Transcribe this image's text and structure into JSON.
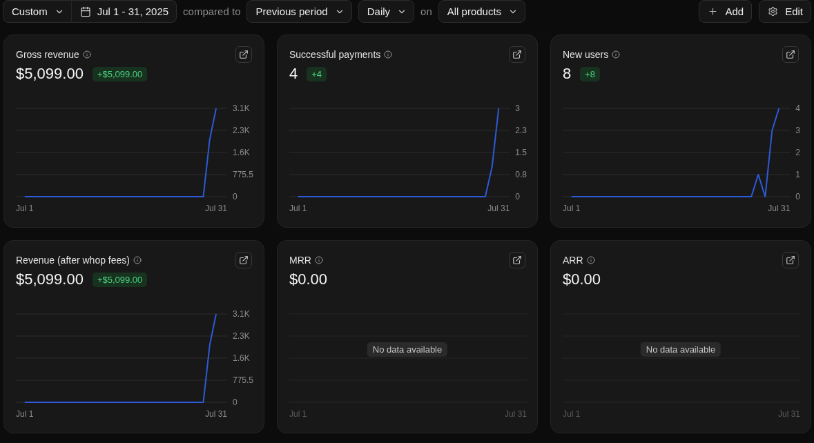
{
  "toolbar": {
    "range_select": "Custom",
    "date_range": "Jul 1 - 31, 2025",
    "compare_label": "compared to",
    "compare_select": "Previous period",
    "interval_select": "Daily",
    "on_label": "on",
    "product_select": "All products",
    "actions": [
      {
        "kind": "add",
        "label": "Add"
      },
      {
        "kind": "edit",
        "label": "Edit"
      }
    ]
  },
  "cards": [
    {
      "title": "Gross revenue",
      "value": "$5,099.00",
      "change": "+$5,099.00",
      "chart_data": {
        "type": "line",
        "grid": true,
        "categories": [
          "Jul 1",
          null,
          null,
          null,
          null,
          null,
          null,
          null,
          null,
          null,
          null,
          null,
          null,
          null,
          null,
          null,
          null,
          null,
          null,
          null,
          null,
          null,
          null,
          null,
          null,
          null,
          null,
          null,
          null,
          null,
          "Jul 31"
        ],
        "series": [
          {
            "color": "#2d5bd8",
            "values": [
              0,
              0,
              0,
              0,
              0,
              0,
              0,
              0,
              0,
              0,
              0,
              0,
              0,
              0,
              0,
              0,
              0,
              0,
              0,
              0,
              0,
              0,
              0,
              0,
              0,
              0,
              0,
              0,
              0,
              2000,
              3100
            ]
          }
        ],
        "ylim": [
          0,
          3102
        ],
        "yticks": [
          {
            "value": 0,
            "label": "0"
          },
          {
            "value": 775.5,
            "label": "775.5"
          },
          {
            "value": 1551,
            "label": "1.6K"
          },
          {
            "value": 2326.5,
            "label": "2.3K"
          },
          {
            "value": 3102,
            "label": "3.1K"
          }
        ]
      }
    },
    {
      "title": "Successful payments",
      "value": "4",
      "change": "+4",
      "chart_data": {
        "type": "line",
        "grid": true,
        "categories": [
          "Jul 1",
          null,
          null,
          null,
          null,
          null,
          null,
          null,
          null,
          null,
          null,
          null,
          null,
          null,
          null,
          null,
          null,
          null,
          null,
          null,
          null,
          null,
          null,
          null,
          null,
          null,
          null,
          null,
          null,
          null,
          "Jul 31"
        ],
        "series": [
          {
            "color": "#2d5bd8",
            "values": [
              0,
              0,
              0,
              0,
              0,
              0,
              0,
              0,
              0,
              0,
              0,
              0,
              0,
              0,
              0,
              0,
              0,
              0,
              0,
              0,
              0,
              0,
              0,
              0,
              0,
              0,
              0,
              0,
              0,
              1,
              3
            ]
          }
        ],
        "ylim": [
          0,
          3
        ],
        "yticks": [
          {
            "value": 0,
            "label": "0"
          },
          {
            "value": 0.75,
            "label": "0.8"
          },
          {
            "value": 1.5,
            "label": "1.5"
          },
          {
            "value": 2.25,
            "label": "2.3"
          },
          {
            "value": 3,
            "label": "3"
          }
        ]
      }
    },
    {
      "title": "New users",
      "value": "8",
      "change": "+8",
      "chart_data": {
        "type": "line",
        "grid": true,
        "categories": [
          "Jul 1",
          null,
          null,
          null,
          null,
          null,
          null,
          null,
          null,
          null,
          null,
          null,
          null,
          null,
          null,
          null,
          null,
          null,
          null,
          null,
          null,
          null,
          null,
          null,
          null,
          null,
          null,
          null,
          null,
          null,
          "Jul 31"
        ],
        "series": [
          {
            "color": "#2d5bd8",
            "values": [
              0,
              0,
              0,
              0,
              0,
              0,
              0,
              0,
              0,
              0,
              0,
              0,
              0,
              0,
              0,
              0,
              0,
              0,
              0,
              0,
              0,
              0,
              0,
              0,
              0,
              0,
              0,
              1,
              0,
              3,
              4
            ]
          }
        ],
        "ylim": [
          0,
          4
        ],
        "yticks": [
          0,
          1,
          2,
          3,
          4
        ]
      }
    },
    {
      "title": "Revenue (after whop fees)",
      "value": "$5,099.00",
      "change": "+$5,099.00",
      "chart_data": {
        "type": "line",
        "grid": true,
        "categories": [
          "Jul 1",
          null,
          null,
          null,
          null,
          null,
          null,
          null,
          null,
          null,
          null,
          null,
          null,
          null,
          null,
          null,
          null,
          null,
          null,
          null,
          null,
          null,
          null,
          null,
          null,
          null,
          null,
          null,
          null,
          null,
          "Jul 31"
        ],
        "series": [
          {
            "color": "#2d5bd8",
            "values": [
              0,
              0,
              0,
              0,
              0,
              0,
              0,
              0,
              0,
              0,
              0,
              0,
              0,
              0,
              0,
              0,
              0,
              0,
              0,
              0,
              0,
              0,
              0,
              0,
              0,
              0,
              0,
              0,
              0,
              2000,
              3100
            ]
          }
        ],
        "ylim": [
          0,
          3102
        ],
        "yticks": [
          {
            "value": 0,
            "label": "0"
          },
          {
            "value": 775.5,
            "label": "775.5"
          },
          {
            "value": 1551,
            "label": "1.6K"
          },
          {
            "value": 2326.5,
            "label": "2.3K"
          },
          {
            "value": 3102,
            "label": "3.1K"
          }
        ]
      }
    },
    {
      "title": "MRR",
      "value": "$0.00",
      "empty_chart": {
        "x_labels": [
          "Jul 1",
          "Jul 31"
        ],
        "message": "No data available"
      }
    },
    {
      "title": "ARR",
      "value": "$0.00",
      "empty_chart": {
        "x_labels": [
          "Jul 1",
          "Jul 31"
        ],
        "message": "No data available"
      }
    }
  ]
}
